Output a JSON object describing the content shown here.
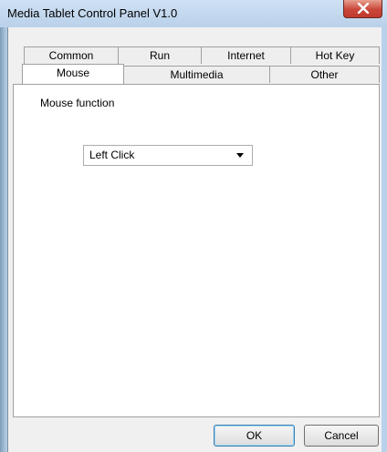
{
  "window": {
    "title": "Media Tablet Control Panel V1.0",
    "close_glyph": "X"
  },
  "tabs": {
    "row1": [
      {
        "label": "Common"
      },
      {
        "label": "Run"
      },
      {
        "label": "Internet"
      },
      {
        "label": "Hot Key"
      }
    ],
    "row2": [
      {
        "label": "Mouse",
        "selected": true
      },
      {
        "label": "Multimedia"
      },
      {
        "label": "Other"
      }
    ]
  },
  "mouse_panel": {
    "section_label": "Mouse function",
    "mouse_function_value": "Left Click"
  },
  "buttons": {
    "ok": "OK",
    "cancel": "Cancel"
  },
  "colors": {
    "frame": "#b9d1ea",
    "close_button": "#c9463a",
    "client": "#f0f0f0"
  }
}
